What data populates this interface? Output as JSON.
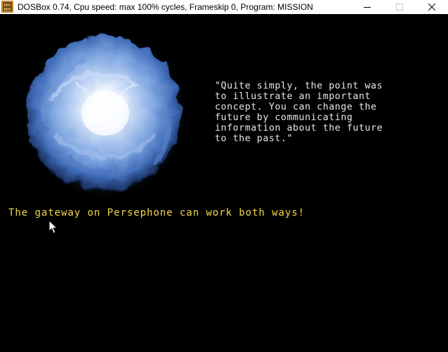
{
  "window": {
    "title": "DOSBox 0.74, Cpu speed: max 100% cycles, Frameskip  0, Program:  MISSION",
    "icon": "dosbox-app-icon",
    "icon_text_top": "DOS",
    "icon_text_bottom": "BOX",
    "controls": {
      "minimize": "minimize-icon",
      "maximize": "maximize-icon",
      "close": "close-icon"
    }
  },
  "game": {
    "image": "glowing-blue-sphere",
    "quote_lines": [
      "\"Quite simply, the point was",
      "to illustrate an important",
      "concept. You can change the",
      "future by communicating",
      "information about the future",
      "to the past.\""
    ],
    "caption": "The gateway on Persephone can work both ways!",
    "colors": {
      "background": "#000000",
      "quote_text": "#e8e8e8",
      "caption_text": "#f4d64a",
      "orb_core": "#ffffff",
      "orb_mid": "#8fb4e8",
      "orb_edge": "#2a4f9a"
    }
  }
}
